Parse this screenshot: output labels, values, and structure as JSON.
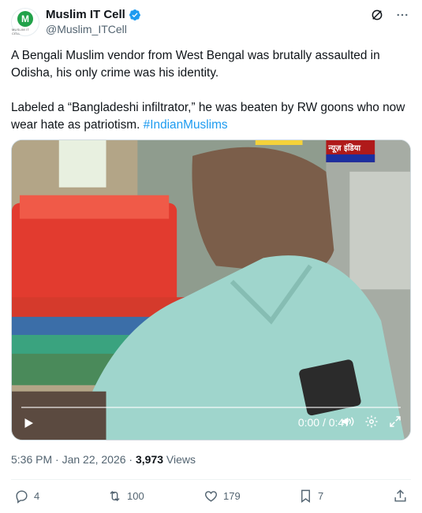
{
  "author": {
    "display_name": "Muslim IT Cell",
    "handle": "@Muslim_ITCell",
    "avatar_letter": "M",
    "avatar_caption": "MUSLIM IT CELL",
    "verified_color": "#1d9bf0"
  },
  "tweet": {
    "paragraph1": "A Bengali Muslim vendor from West Bengal was brutally assaulted in Odisha, his only crime was his identity.",
    "paragraph2": "Labeled a “Bangladeshi infiltrator,” he was beaten by RW goons who now wear hate as patriotism.",
    "hashtag": "#IndianMuslims"
  },
  "video": {
    "channel_badge": "न्यूज़ इंडिया",
    "time_display": "0:00 / 0:47",
    "progress": 0
  },
  "meta": {
    "timestamp": "5:36 PM · Jan 22, 2026 · ",
    "views_count": "3,973",
    "views_label": " Views"
  },
  "actions": {
    "replies": "4",
    "reposts": "100",
    "likes": "179",
    "bookmarks": "7"
  },
  "colors": {
    "accent": "#1d9bf0",
    "secondary_text": "#536471"
  }
}
